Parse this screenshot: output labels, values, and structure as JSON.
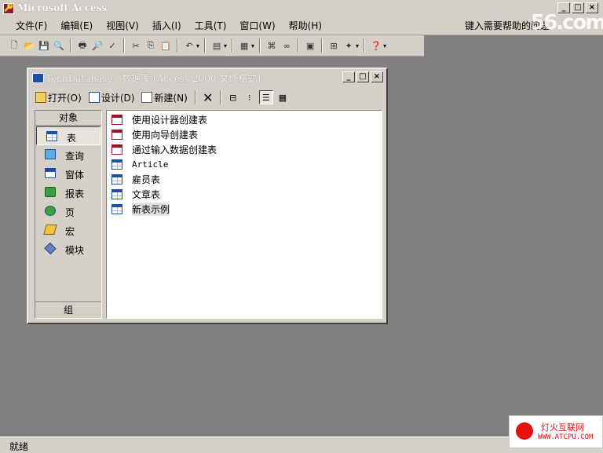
{
  "app": {
    "title": "Microsoft Access"
  },
  "menu": {
    "items": [
      "文件(F)",
      "编辑(E)",
      "视图(V)",
      "插入(I)",
      "工具(T)",
      "窗口(W)",
      "帮助(H)"
    ],
    "help_placeholder": "键入需要帮助的问题"
  },
  "db_window": {
    "title": "TechDatabase : 数据库 (Access 2000 文件格式)",
    "toolbar": {
      "open": "打开(O)",
      "design": "设计(D)",
      "new": "新建(N)"
    },
    "objects_header": "对象",
    "objects": [
      "表",
      "查询",
      "窗体",
      "报表",
      "页",
      "宏",
      "模块"
    ],
    "selected_object": "表",
    "groups_label": "组",
    "items": [
      "使用设计器创建表",
      "使用向导创建表",
      "通过输入数据创建表",
      "Article",
      "雇员表",
      "文章表",
      "新表示例"
    ],
    "selected_item": "新表示例"
  },
  "status": {
    "text": "就绪"
  },
  "watermarks": {
    "logo": "56.com",
    "site_cn": "灯火互联网",
    "site_url": "WWW.ATCPU.COM"
  }
}
